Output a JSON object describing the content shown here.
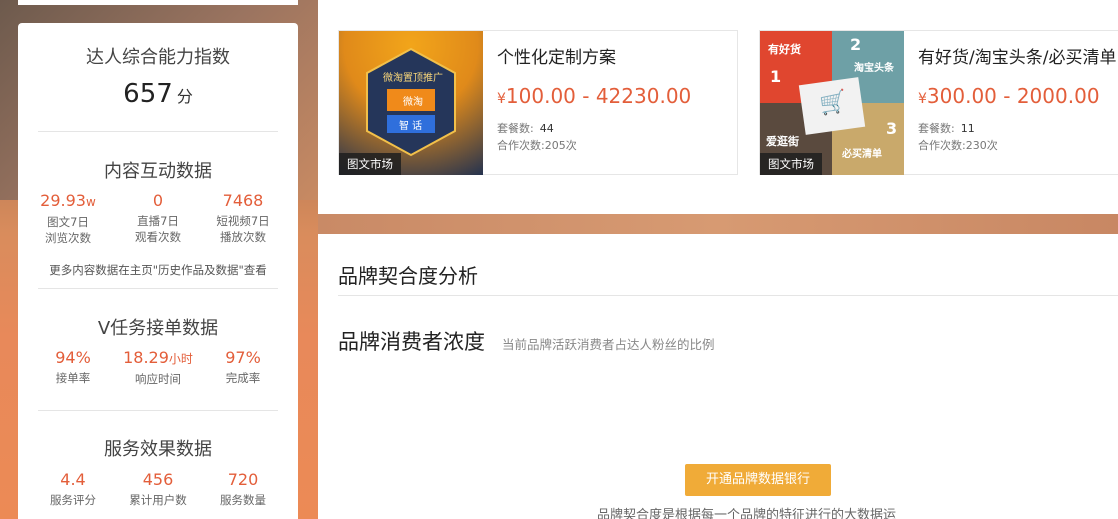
{
  "left": {
    "score_title": "达人综合能力指数",
    "score_value": "657",
    "score_unit": "分",
    "content": {
      "title": "内容互动数据",
      "stats": [
        {
          "num": "29.93",
          "suffix": "w",
          "label1": "图文7日",
          "label2": "浏览次数"
        },
        {
          "num": "0",
          "suffix": "",
          "label1": "直播7日",
          "label2": "观看次数"
        },
        {
          "num": "7468",
          "suffix": "",
          "label1": "短视频7日",
          "label2": "播放次数"
        }
      ],
      "note": "更多内容数据在主页\"历史作品及数据\"查看"
    },
    "vtask": {
      "title": "V任务接单数据",
      "stats": [
        {
          "num": "94%",
          "suffix": "",
          "label": "接单率"
        },
        {
          "num": "18.29",
          "suffix": "小时",
          "label": "响应时间"
        },
        {
          "num": "97%",
          "suffix": "",
          "label": "完成率"
        }
      ]
    },
    "service": {
      "title": "服务效果数据",
      "stats": [
        {
          "num": "4.4",
          "label": "服务评分"
        },
        {
          "num": "456",
          "label": "累计用户数"
        },
        {
          "num": "720",
          "label": "服务数量"
        }
      ]
    }
  },
  "cards": [
    {
      "title": "个性化定制方案",
      "price": "100.00 - 42230.00",
      "yen": "¥",
      "tag": "图文市场",
      "sets_label": "套餐数:",
      "sets": "44",
      "coop_label": "合作次数:",
      "coop": "205次",
      "thumb_text": {
        "top": "微淘置顶推广",
        "b1": "微淘",
        "b2": "智 话"
      }
    },
    {
      "title": "有好货/淘宝头条/必买清单",
      "price": "300.00 - 2000.00",
      "yen": "¥",
      "tag": "图文市场",
      "sets_label": "套餐数:",
      "sets": "11",
      "coop_label": "合作次数:",
      "coop": "230次",
      "thumb_text": {
        "q1": "有好货",
        "n1": "1",
        "q2": "淘宝头条",
        "n2": "2",
        "q3": "爱逛街",
        "q4": "必买清单",
        "n3": "3"
      }
    }
  ],
  "brand": {
    "title": "品牌契合度分析",
    "sub_title": "品牌消费者浓度",
    "sub_note": "当前品牌活跃消费者占达人粉丝的比例",
    "button": "开通品牌数据银行",
    "footer": "品牌契合度是根据每一个品牌的特征进行的大数据运"
  }
}
